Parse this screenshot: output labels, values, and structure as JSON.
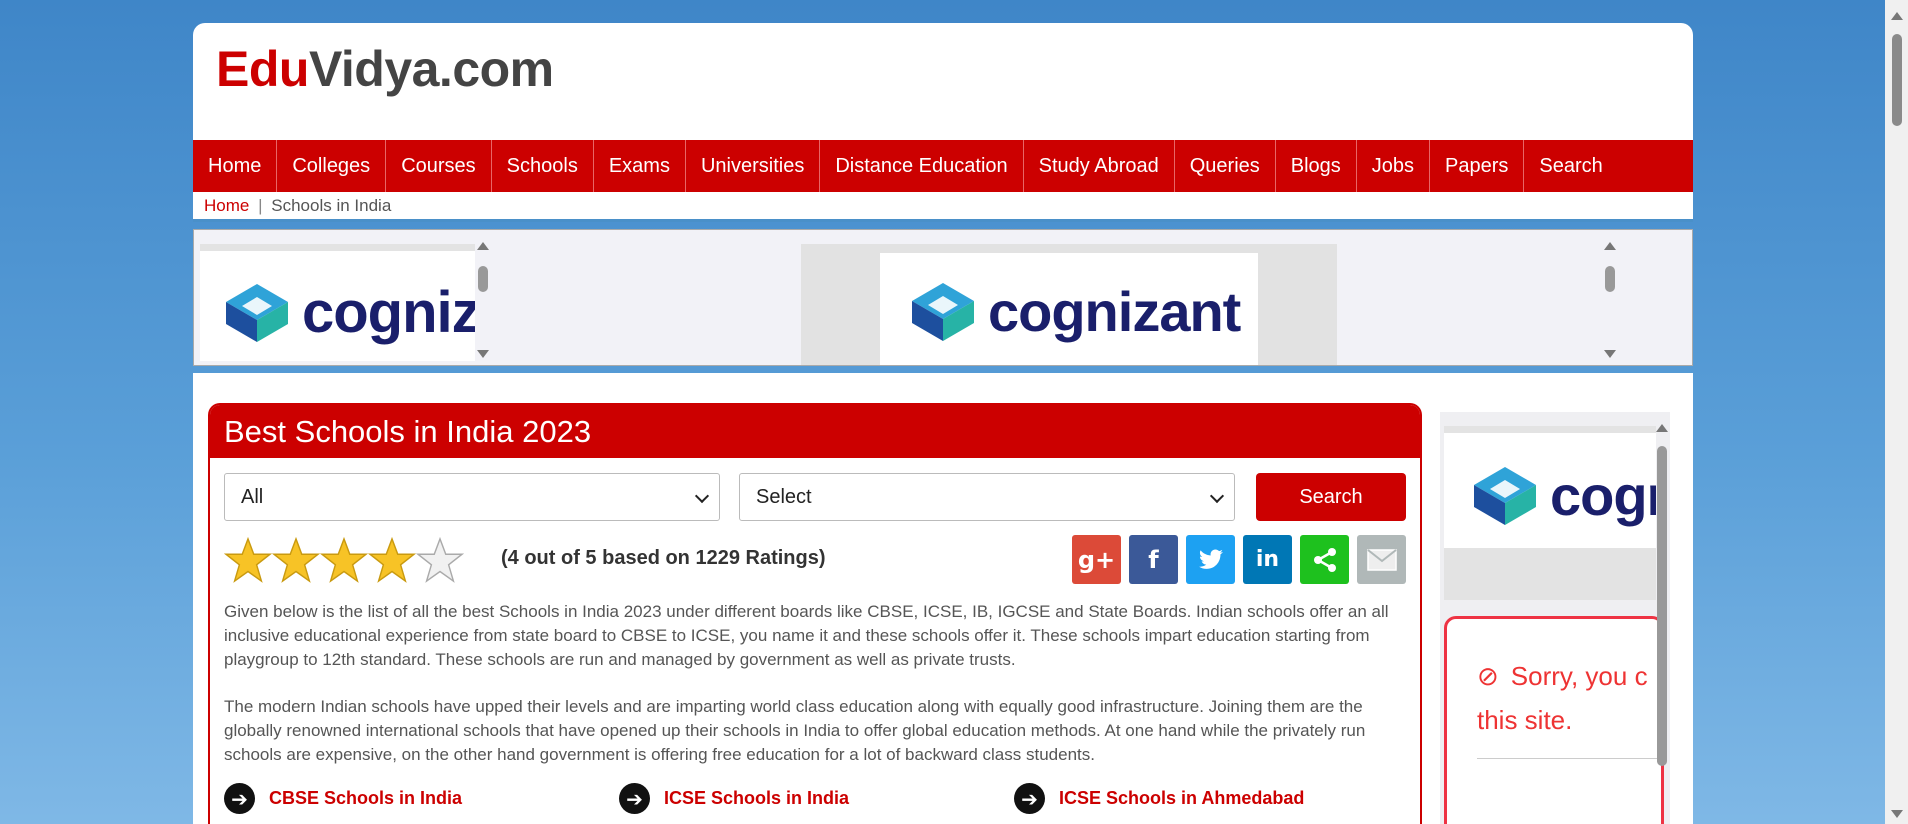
{
  "logo": {
    "part1": "Edu",
    "part2": "Vidya.com"
  },
  "nav": {
    "items": [
      "Home",
      "Colleges",
      "Courses",
      "Schools",
      "Exams",
      "Universities",
      "Distance Education",
      "Study Abroad",
      "Queries",
      "Blogs",
      "Jobs",
      "Papers",
      "Search"
    ]
  },
  "breadcrumb": {
    "home": "Home",
    "separator": "|",
    "current": "Schools in India"
  },
  "ads": {
    "brand_partial": "cogniz",
    "brand_full": "cognizant",
    "brand_side": "cogni"
  },
  "panel": {
    "title": "Best Schools in India 2023",
    "filter1_value": "All",
    "filter2_value": "Select",
    "search_label": "Search",
    "rating": {
      "stars_filled": 4,
      "stars_total": 5,
      "text": "(4 out of 5 based on 1229 Ratings)"
    },
    "share_icons": [
      "google-plus",
      "facebook",
      "twitter",
      "linkedin",
      "share",
      "email"
    ],
    "paragraph1": "Given below is the list of all the best Schools in India 2023 under different boards like CBSE, ICSE, IB, IGCSE and State Boards. Indian schools offer an all inclusive educational experience from state board to CBSE to ICSE, you name it and these schools offer it. These schools impart education starting from playgroup to 12th standard. These schools are run and managed by government as well as private trusts.",
    "paragraph2": "The modern Indian schools have upped their levels and are imparting world class education along with equally good infrastructure. Joining them are the globally renowned international schools that have opened up their schools in India to offer global education methods. At one hand while the privately run schools are expensive, on the other hand government is offering free education for a lot of backward class students.",
    "links": [
      "CBSE Schools in India",
      "ICSE Schools in India",
      "ICSE Schools in Ahmedabad"
    ]
  },
  "sidebar": {
    "sorry_line1": "Sorry, you c",
    "sorry_line2": "this site."
  },
  "colors": {
    "brand_red": "#cc0000",
    "text_gray": "#555555",
    "cognizant_navy": "#1a1f6b"
  }
}
